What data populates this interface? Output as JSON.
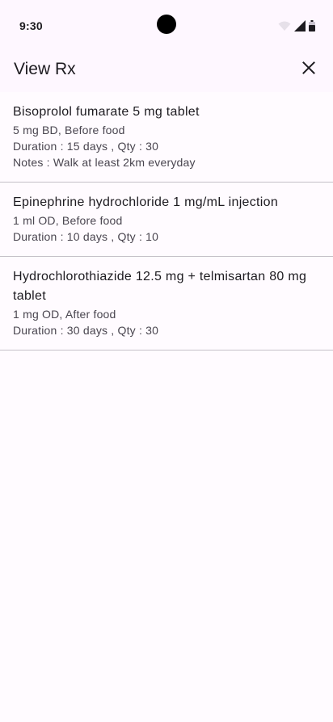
{
  "status_bar": {
    "time": "9:30",
    "icons": [
      "wifi-icon",
      "signal-icon",
      "battery-icon"
    ]
  },
  "app_bar": {
    "title": "View Rx",
    "close_icon": "close-icon"
  },
  "prescriptions": [
    {
      "name": "Bisoprolol fumarate 5 mg tablet",
      "dosage": "5 mg BD, Before food",
      "duration": "Duration : 15 days , Qty : 30",
      "notes": "Notes : Walk at least 2km everyday"
    },
    {
      "name": "Epinephrine hydrochloride 1 mg/mL injection",
      "dosage": "1 ml OD, Before food",
      "duration": "Duration : 10 days , Qty : 10"
    },
    {
      "name": "Hydrochlorothiazide 12.5 mg + telmisartan 80 mg tablet",
      "dosage": "1 mg OD, After food",
      "duration": "Duration : 30 days , Qty : 30"
    }
  ],
  "colors": {
    "background": "#fef7ff",
    "list_background": "#fffbff",
    "primary_text": "#1d1b20",
    "secondary_text": "#49454f",
    "divider": "#c4c0c8"
  }
}
